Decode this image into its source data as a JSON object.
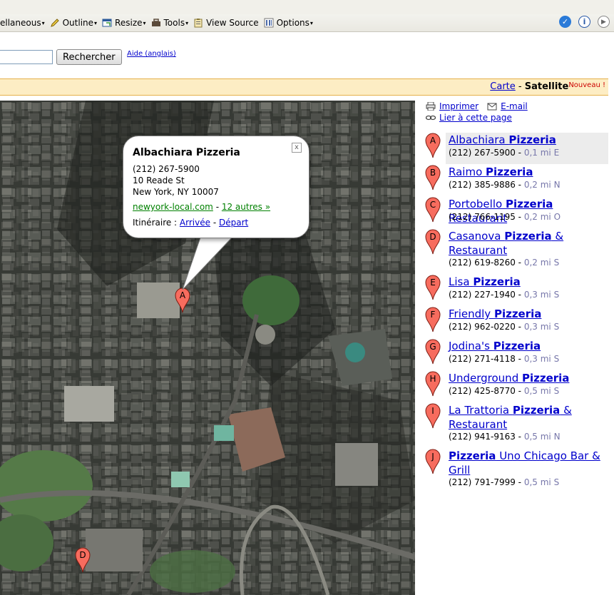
{
  "toolbar": {
    "items": [
      {
        "label": "ellaneous",
        "icon": "menu-icon",
        "arrow": true
      },
      {
        "label": "Outline",
        "icon": "pencil-icon",
        "arrow": true
      },
      {
        "label": "Resize",
        "icon": "resize-icon",
        "arrow": true
      },
      {
        "label": "Tools",
        "icon": "tools-icon",
        "arrow": true
      },
      {
        "label": "View Source",
        "icon": "clipboard-icon",
        "arrow": false
      },
      {
        "label": "Options",
        "icon": "options-icon",
        "arrow": true
      }
    ]
  },
  "search": {
    "value": "",
    "button_label": "Rechercher",
    "help_link": "Aide (anglais)"
  },
  "mapbar": {
    "map_label": "Carte",
    "separator": "-",
    "satellite_label": "Satellite",
    "new_badge": "Nouveau !"
  },
  "bubble": {
    "title": "Albachiara Pizzeria",
    "phone": "(212) 267-5900",
    "street": "10 Reade St",
    "city": "New York, NY 10007",
    "website": "newyork-local.com",
    "dash": " - ",
    "others": "12 autres »",
    "directions_label": "Itinéraire : ",
    "arrival": "Arrivée",
    "departure": "Départ",
    "close": "x"
  },
  "side_links": {
    "print": "Imprimer",
    "email": "E-mail",
    "link": "Lier à cette page"
  },
  "results": [
    {
      "letter": "A",
      "name_pre": "Albachiara ",
      "name_bold": "Pizzeria",
      "name_post": "",
      "phone": "(212) 267-5900",
      "distance": "0,1 mi E",
      "selected": true
    },
    {
      "letter": "B",
      "name_pre": "Raimo ",
      "name_bold": "Pizzeria",
      "name_post": "",
      "phone": "(212) 385-9886",
      "distance": "0,2 mi N"
    },
    {
      "letter": "C",
      "name_pre": "Portobello ",
      "name_bold": "Pizzeria",
      "name_post": " Restaurant",
      "phone": "(212) 766-1195",
      "distance": "0,2 mi O"
    },
    {
      "letter": "D",
      "name_pre": "Casanova ",
      "name_bold": "Pizzeria",
      "name_post": " & Restaurant",
      "phone": "(212) 619-8260",
      "distance": "0,2 mi S"
    },
    {
      "letter": "E",
      "name_pre": "Lisa ",
      "name_bold": "Pizzeria",
      "name_post": "",
      "phone": "(212) 227-1940",
      "distance": "0,3 mi S"
    },
    {
      "letter": "F",
      "name_pre": "Friendly ",
      "name_bold": "Pizzeria",
      "name_post": "",
      "phone": "(212) 962-0220",
      "distance": "0,3 mi S"
    },
    {
      "letter": "G",
      "name_pre": "Jodina's ",
      "name_bold": "Pizzeria",
      "name_post": "",
      "phone": "(212) 271-4118",
      "distance": "0,3 mi S"
    },
    {
      "letter": "H",
      "name_pre": "Underground ",
      "name_bold": "Pizzeria",
      "name_post": "",
      "phone": "(212) 425-8770",
      "distance": "0,5 mi S"
    },
    {
      "letter": "I",
      "name_pre": "La Trattoria ",
      "name_bold": "Pizzeria",
      "name_post": " & Restaurant",
      "phone": "(212) 941-9163",
      "distance": "0,5 mi N"
    },
    {
      "letter": "J",
      "name_pre": "",
      "name_bold": "Pizzeria",
      "name_post": " Uno Chicago Bar & Grill",
      "phone": "(212) 791-7999",
      "distance": "0,5 mi S"
    }
  ],
  "map_markers": [
    {
      "letter": "A"
    },
    {
      "letter": "D"
    }
  ],
  "colors": {
    "marker": "#f76c5e",
    "link": "#0000cc",
    "mapbar": "#fdedc4"
  }
}
